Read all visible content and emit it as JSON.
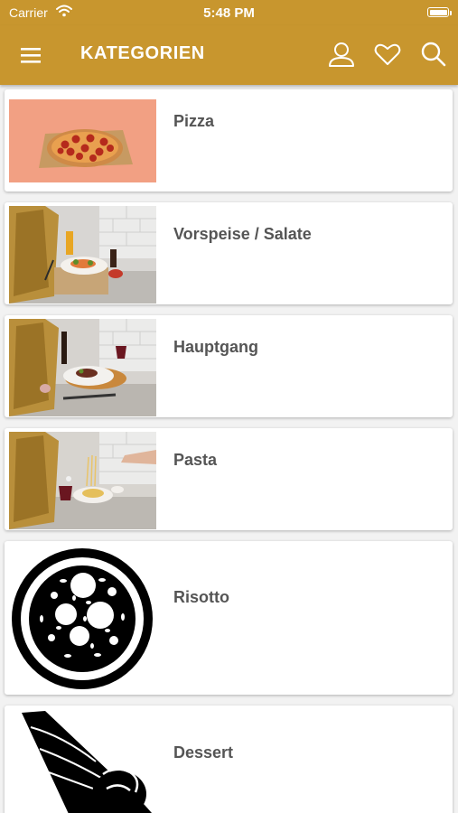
{
  "status_bar": {
    "carrier": "Carrier",
    "time": "5:48 PM",
    "wifi_icon": "wifi-icon",
    "battery_icon": "battery-icon"
  },
  "app_bar": {
    "title": "KATEGORIEN",
    "background_color": "#c8962e",
    "menu_icon": "hamburger-menu-icon",
    "actions": [
      "user-icon",
      "heart-icon",
      "search-icon"
    ]
  },
  "categories": [
    {
      "label": "Pizza",
      "image": "pizza-photo"
    },
    {
      "label": "Vorspeise / Salate",
      "image": "starter-salad-photo"
    },
    {
      "label": "Hauptgang",
      "image": "main-course-photo"
    },
    {
      "label": "Pasta",
      "image": "pasta-photo"
    },
    {
      "label": "Risotto",
      "image": "risotto-icon"
    },
    {
      "label": "Dessert",
      "image": "ice-cream-icon"
    }
  ]
}
